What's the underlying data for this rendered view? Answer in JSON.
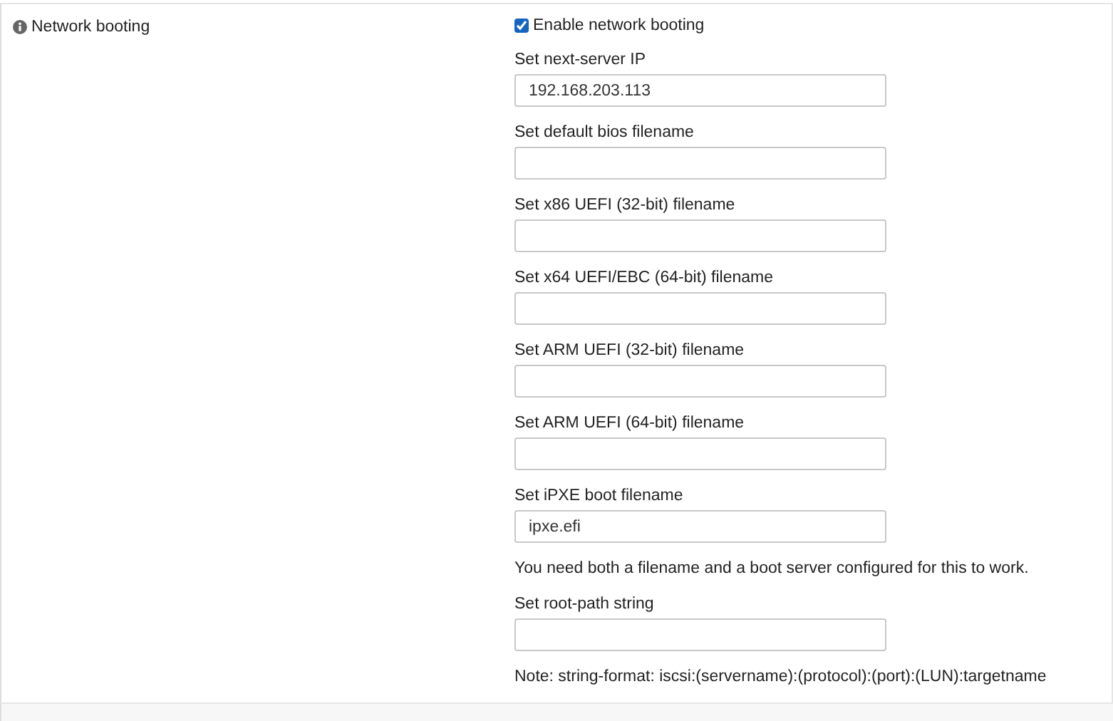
{
  "section": {
    "title": "Network booting"
  },
  "enable": {
    "label": "Enable network booting",
    "checked": true
  },
  "items": [
    {
      "kind": "field",
      "label": "Set next-server IP",
      "value": "192.168.203.113"
    },
    {
      "kind": "field",
      "label": "Set default bios filename"
    },
    {
      "kind": "field",
      "label": "Set x86 UEFI (32-bit) filename"
    },
    {
      "kind": "field",
      "label": "Set x64 UEFI/EBC (64-bit) filename"
    },
    {
      "kind": "field",
      "label": "Set ARM UEFI (32-bit) filename"
    },
    {
      "kind": "field",
      "label": "Set ARM UEFI (64-bit) filename"
    },
    {
      "kind": "field",
      "label": "Set iPXE boot filename",
      "value": "ipxe.efi"
    },
    {
      "kind": "note",
      "text": "You need both a filename and a boot server configured for this to work."
    },
    {
      "kind": "field",
      "label": "Set root-path string"
    },
    {
      "kind": "note",
      "text": "Note: string-format: iscsi:(servername):(protocol):(port):(LUN):targetname"
    }
  ]
}
